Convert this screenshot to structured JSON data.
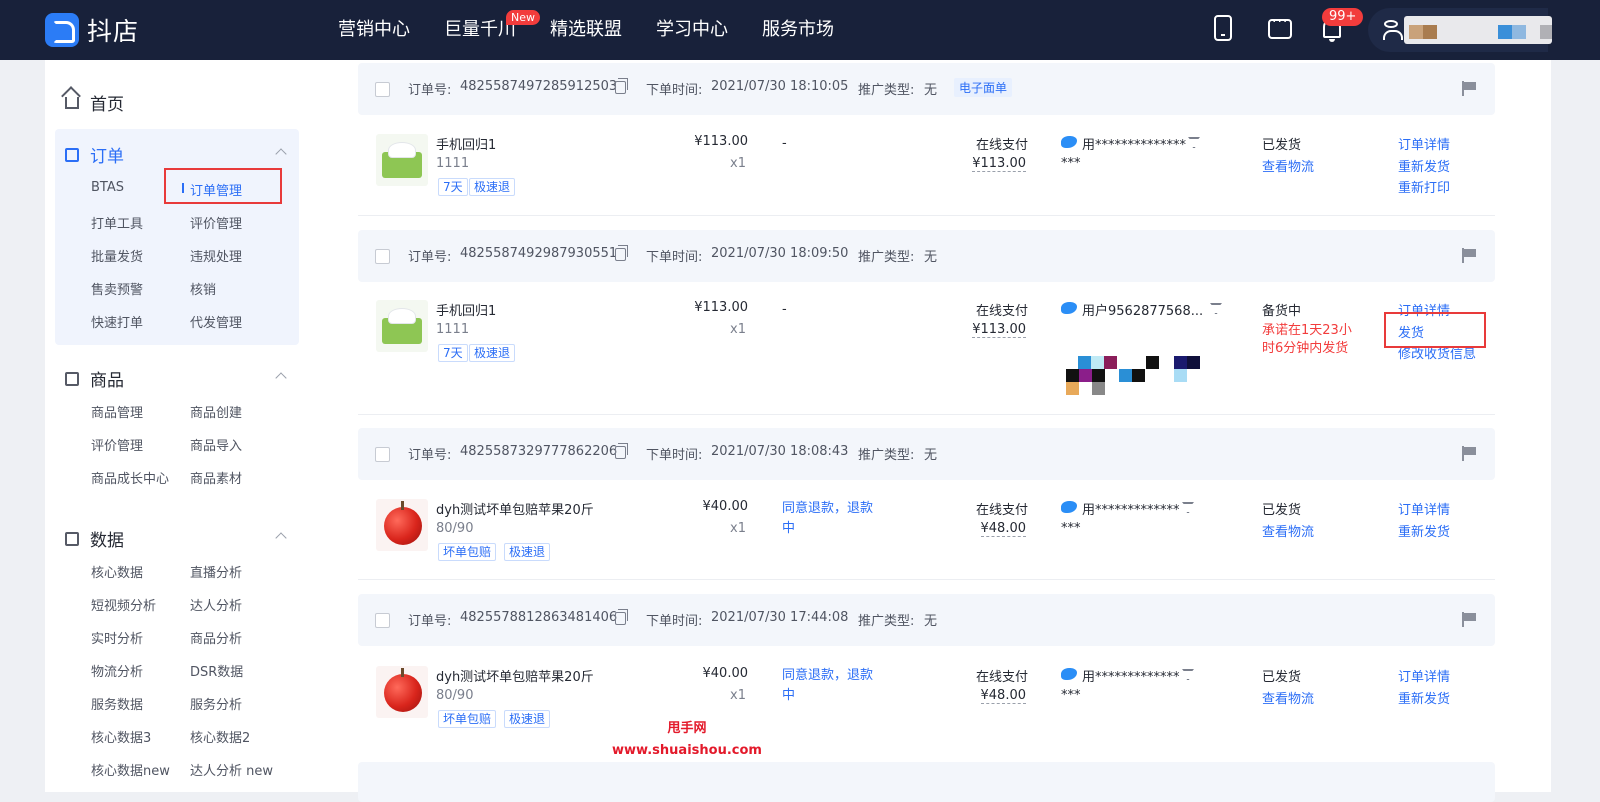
{
  "header": {
    "logo_text": "抖店",
    "nav": [
      "营销中心",
      "巨量千川",
      "精选联盟",
      "学习中心",
      "服务市场"
    ],
    "nav_badge": "New",
    "bell_badge": "99+"
  },
  "sidebar": {
    "home": "首页",
    "order": {
      "title": "订单",
      "items": [
        "BTAS",
        "订单管理",
        "打单工具",
        "评价管理",
        "批量发货",
        "违规处理",
        "售卖预警",
        "核销",
        "快速打单",
        "代发管理"
      ]
    },
    "product": {
      "title": "商品",
      "items": [
        "商品管理",
        "商品创建",
        "评价管理",
        "商品导入",
        "商品成长中心",
        "商品素材"
      ]
    },
    "data": {
      "title": "数据",
      "items": [
        "核心数据",
        "直播分析",
        "短视频分析",
        "达人分析",
        "实时分析",
        "商品分析",
        "物流分析",
        "DSR数据",
        "服务数据",
        "服务分析",
        "核心数据3",
        "核心数据2",
        "核心数据new",
        "达人分析 new"
      ]
    }
  },
  "labels": {
    "order_no": "订单号:",
    "order_time": "下单时间:",
    "promo": "推广类型:",
    "none": "无",
    "e_waybill": "电子面单",
    "pay_method": "在线支付"
  },
  "orders": [
    {
      "no": "4825587497285912503",
      "time": "2021/07/30 18:10:05",
      "product": "手机回归1",
      "spec": "1111",
      "tags": [
        "7天",
        "极速退"
      ],
      "price": "¥113.00",
      "qty": "x1",
      "after": "-",
      "paid": "¥113.00",
      "buyer": "用**************",
      "buyer2": "***",
      "status": "已发货",
      "status_sub": "查看物流",
      "ops": [
        "订单详情",
        "重新发货",
        "重新打印"
      ]
    },
    {
      "no": "4825587492987930551",
      "time": "2021/07/30 18:09:50",
      "product": "手机回归1",
      "spec": "1111",
      "tags": [
        "7天",
        "极速退"
      ],
      "price": "¥113.00",
      "qty": "x1",
      "after": "-",
      "paid": "¥113.00",
      "buyer": "用户9562877568...",
      "status": "备货中",
      "status_sub": "承诺在1天23小时6分钟内发货",
      "ops": [
        "订单详情",
        "发货",
        "修改收货信息"
      ]
    },
    {
      "no": "4825587329777862206",
      "time": "2021/07/30 18:08:43",
      "product": "dyh测试坏单包赔苹果20斤",
      "spec": "80/90",
      "tags": [
        "坏单包赔",
        "极速退"
      ],
      "price": "¥40.00",
      "qty": "x1",
      "after": "同意退款，退款中",
      "paid": "¥48.00",
      "buyer": "用*************",
      "buyer2": "***",
      "status": "已发货",
      "status_sub": "查看物流",
      "ops": [
        "订单详情",
        "重新发货"
      ]
    },
    {
      "no": "4825578812863481406",
      "time": "2021/07/30 17:44:08",
      "product": "dyh测试坏单包赔苹果20斤",
      "spec": "80/90",
      "tags": [
        "坏单包赔",
        "极速退"
      ],
      "price": "¥40.00",
      "qty": "x1",
      "after": "同意退款，退款中",
      "paid": "¥48.00",
      "buyer": "用*************",
      "buyer2": "***",
      "status": "已发货",
      "status_sub": "查看物流",
      "ops": [
        "订单详情",
        "重新发货"
      ]
    }
  ],
  "watermark": {
    "line1": "甩手网",
    "line2": "www.shuaishou.com"
  },
  "colors": {
    "topbar": "#18213a",
    "accent": "#2b6ef6",
    "danger": "#f23c3c",
    "highlight_box": "#e83a3a"
  }
}
